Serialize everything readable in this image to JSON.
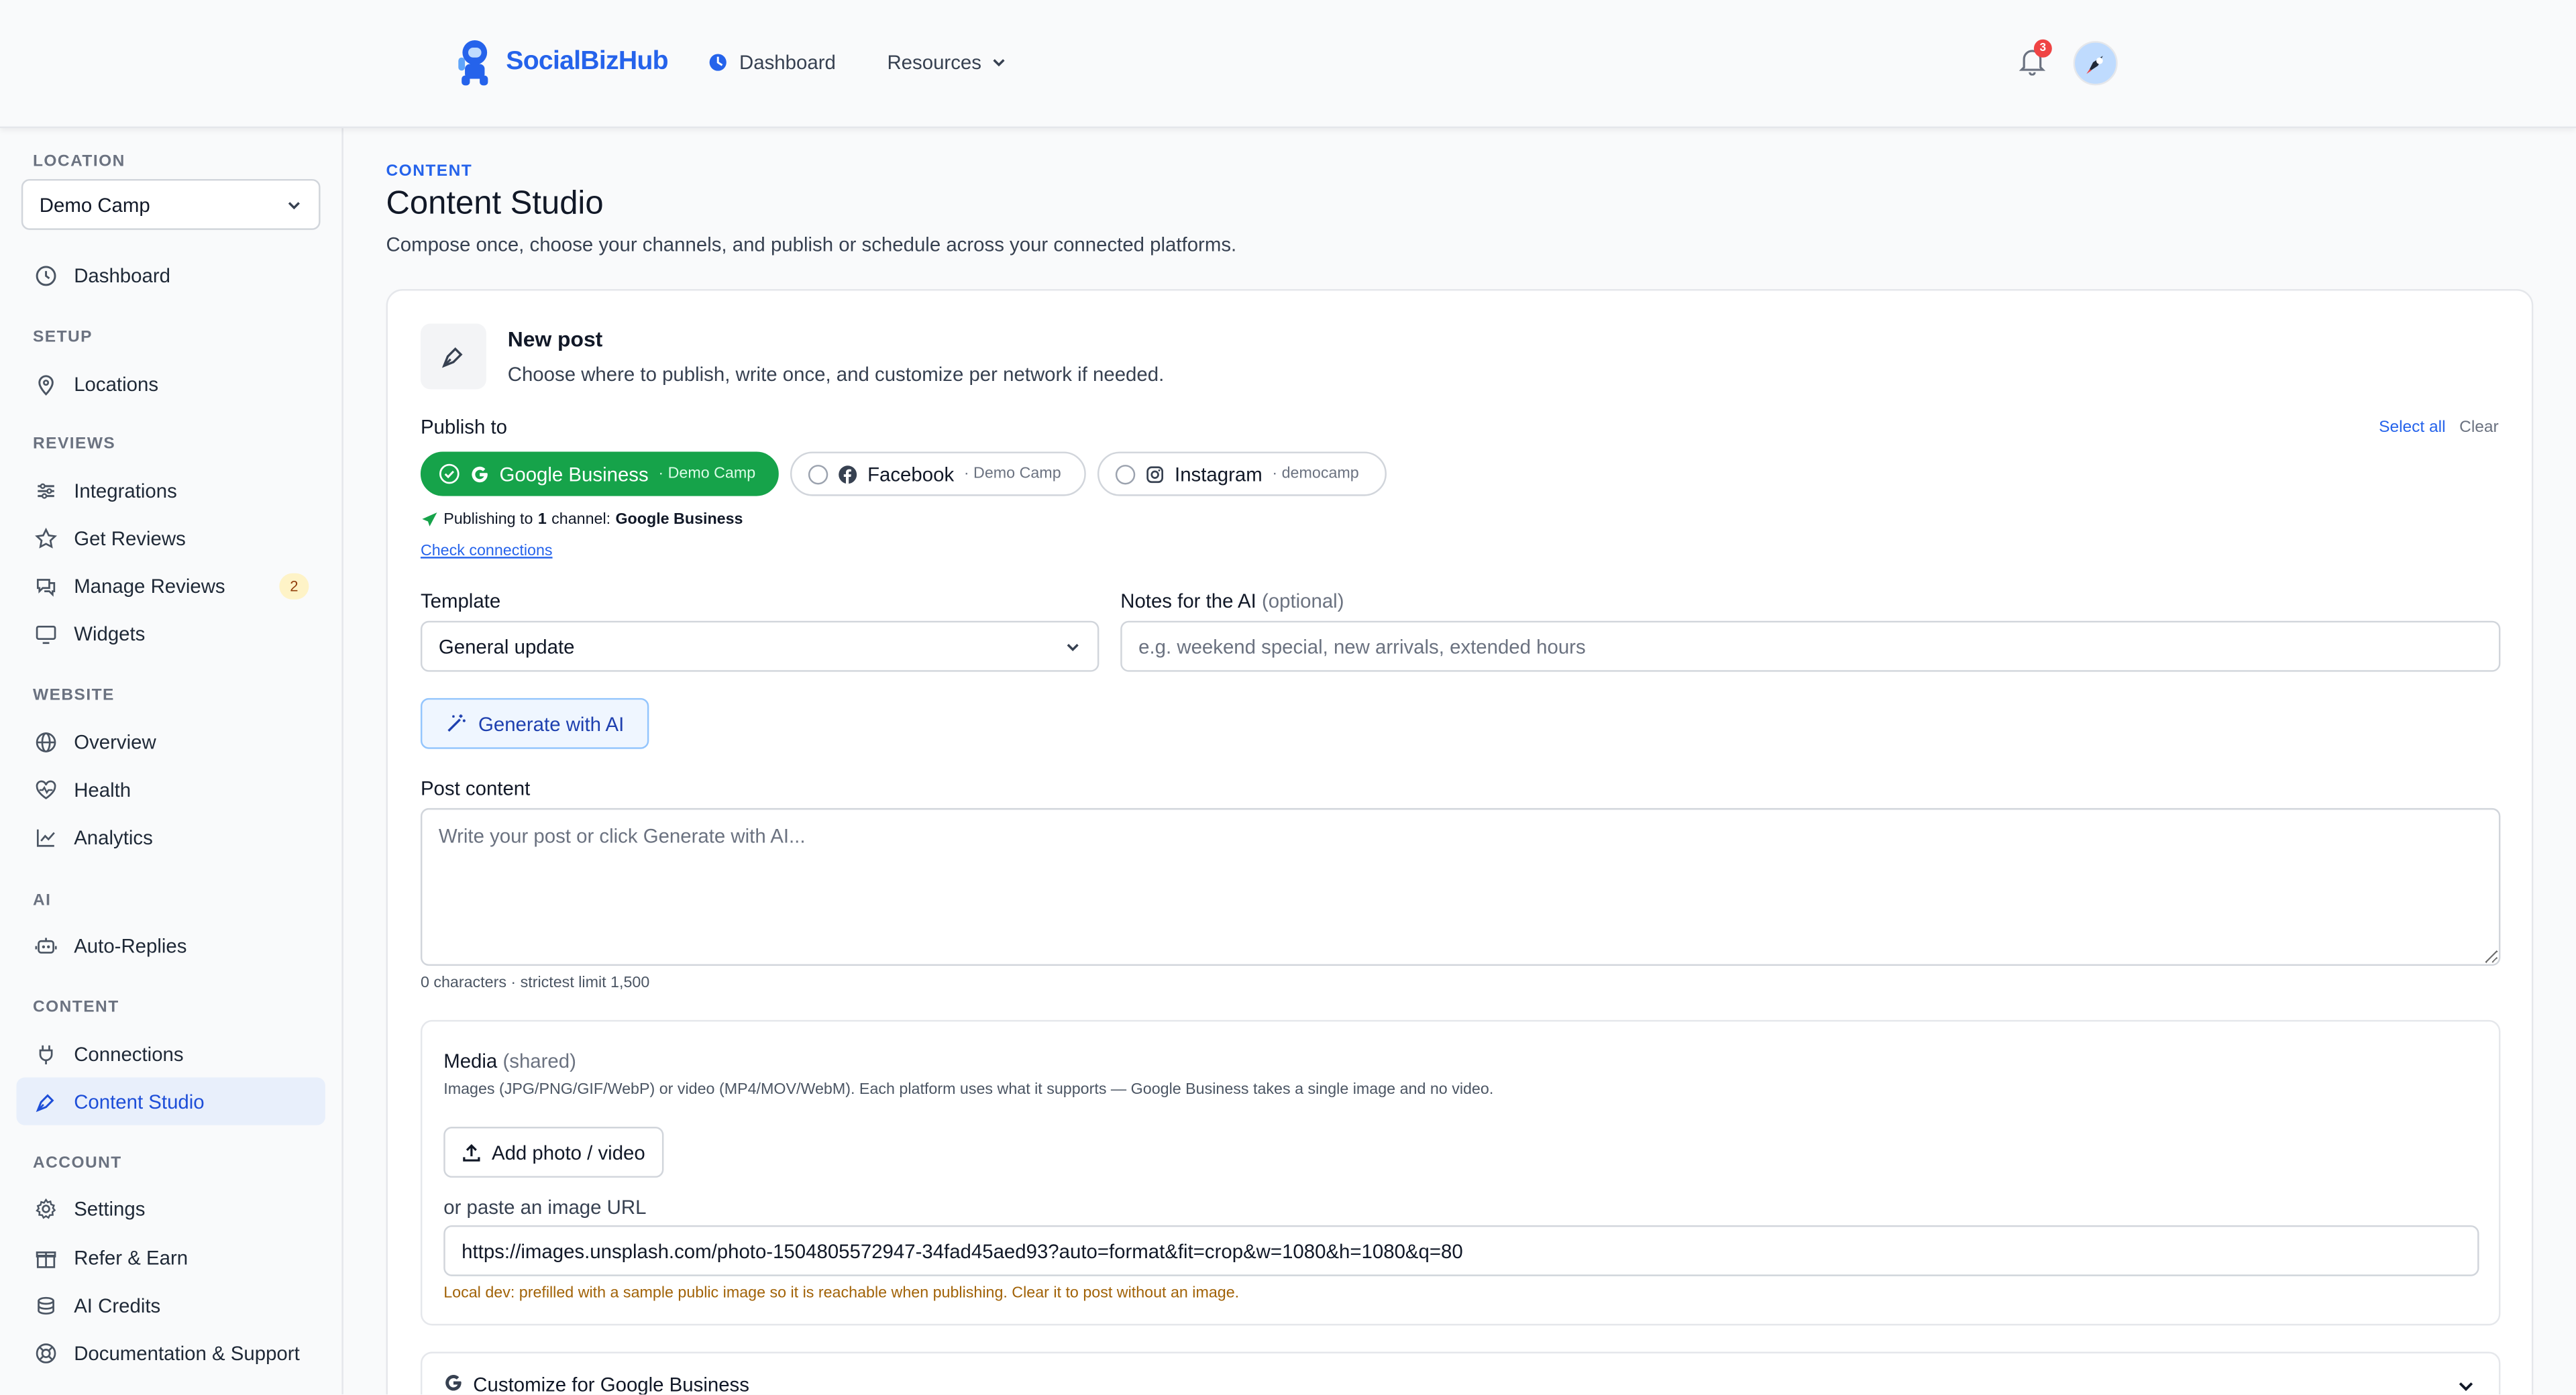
{
  "app": {
    "brand": "SocialBizHub"
  },
  "topnav": {
    "dashboard": "Dashboard",
    "resources": "Resources",
    "notification_count": "3"
  },
  "sidebar": {
    "location_label": "LOCATION",
    "location_value": "Demo Camp",
    "dashboard": "Dashboard",
    "sections": {
      "setup": "SETUP",
      "reviews": "REVIEWS",
      "website": "WEBSITE",
      "ai": "AI",
      "content": "CONTENT",
      "account": "ACCOUNT"
    },
    "items": {
      "locations": "Locations",
      "integrations": "Integrations",
      "get_reviews": "Get Reviews",
      "manage_reviews": "Manage Reviews",
      "manage_reviews_badge": "2",
      "widgets": "Widgets",
      "overview": "Overview",
      "health": "Health",
      "analytics": "Analytics",
      "auto_replies": "Auto-Replies",
      "connections": "Connections",
      "content_studio": "Content Studio",
      "settings": "Settings",
      "refer_earn": "Refer & Earn",
      "ai_credits": "AI Credits",
      "docs_support": "Documentation & Support"
    }
  },
  "page": {
    "eyebrow": "CONTENT",
    "title": "Content Studio",
    "subtitle": "Compose once, choose your channels, and publish or schedule across your connected platforms."
  },
  "post": {
    "title": "New post",
    "subtitle": "Choose where to publish, write once, and customize per network if needed.",
    "publish_to_label": "Publish to",
    "select_all": "Select all",
    "clear": "Clear",
    "channels": [
      {
        "name": "Google Business",
        "account": "· Demo Camp",
        "selected": true
      },
      {
        "name": "Facebook",
        "account": "· Demo Camp",
        "selected": false
      },
      {
        "name": "Instagram",
        "account": "· democamp",
        "selected": false
      }
    ],
    "publishing_prefix": "Publishing to ",
    "publishing_count": "1",
    "publishing_mid": " channel: ",
    "publishing_channel": "Google Business",
    "check_connections": "Check connections",
    "template_label": "Template",
    "template_value": "General update",
    "notes_label": "Notes for the AI",
    "notes_optional": "(optional)",
    "notes_placeholder": "e.g. weekend special, new arrivals, extended hours",
    "generate_button": "Generate with AI",
    "content_label": "Post content",
    "content_placeholder": "Write your post or click Generate with AI...",
    "counter": "0 characters · strictest limit 1,500"
  },
  "media": {
    "title": "Media",
    "title_note": "(shared)",
    "description": "Images (JPG/PNG/GIF/WebP) or video (MP4/MOV/WebM). Each platform uses what it supports — Google Business takes a single image and no video.",
    "upload_button": "Add photo / video",
    "paste_label": "or paste an image URL",
    "url_value": "https://images.unsplash.com/photo-1504805572947-34fad45aed93?auto=format&fit=crop&w=1080&h=1080&q=80",
    "note": "Local dev: prefilled with a sample public image so it is reachable when publishing. Clear it to post without an image."
  },
  "customize": {
    "label": "Customize for Google Business"
  },
  "colors": {
    "accent": "#2563eb",
    "selected_chip": "#16a34a",
    "badge": "#ef4444",
    "warning_text": "#a16207"
  }
}
